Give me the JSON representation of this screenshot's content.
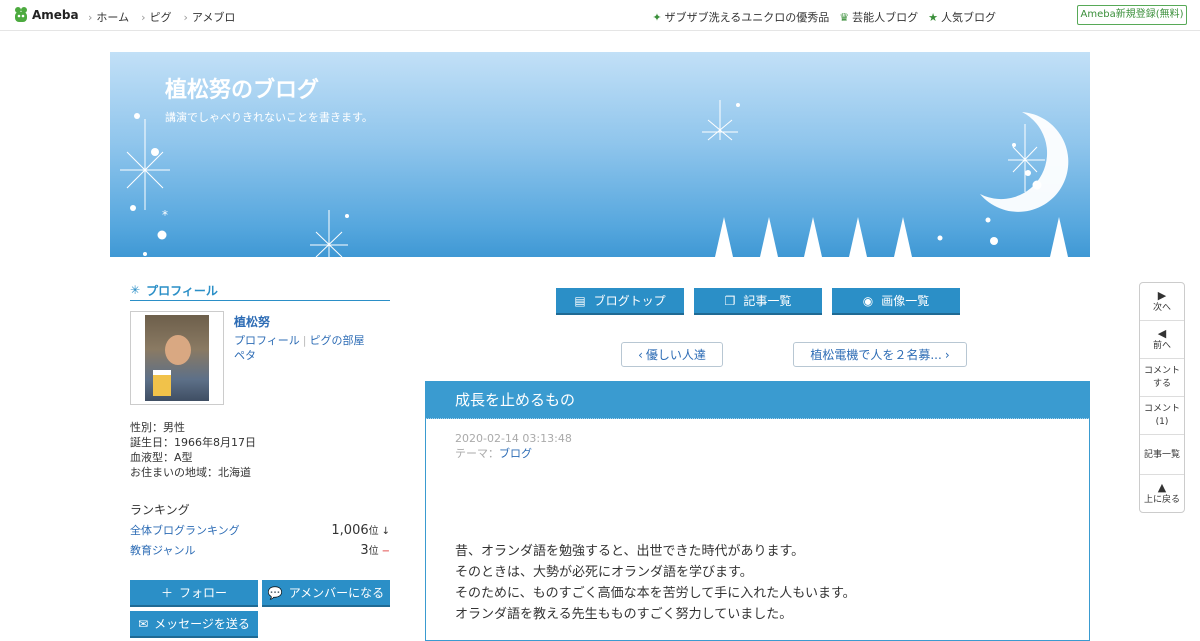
{
  "topbar": {
    "logo": "Ameba",
    "nav_left": [
      "ホーム",
      "ピグ",
      "アメブロ"
    ],
    "nav_right": [
      {
        "icon": "sparkle-icon",
        "label": "ザブザブ洗えるユニクロの優秀品"
      },
      {
        "icon": "crown-icon",
        "label": "芸能人ブログ"
      },
      {
        "icon": "star-icon",
        "label": "人気ブログ"
      }
    ],
    "register": "Ameba新規登録(無料)"
  },
  "banner": {
    "title": "植松努のブログ",
    "subtitle": "講演でしゃべりきれないことを書きます。"
  },
  "sidebar": {
    "heading": "プロフィール",
    "name": "植松努",
    "links": [
      "プロフィール",
      "ピグの部屋",
      "ペタ"
    ],
    "attrs": [
      "性別：男性",
      "誕生日：1966年8月17日",
      "血液型：A型",
      "お住まいの地域：北海道"
    ],
    "ranking_heading": "ランキング",
    "ranking": [
      {
        "label": "全体ブログランキング",
        "value": "1,006",
        "unit": "位",
        "trend": "↓"
      },
      {
        "label": "教育ジャンル",
        "value": "3",
        "unit": "位",
        "trend": "−"
      }
    ],
    "follow": "フォロー",
    "amember": "アメンバーになる",
    "message": "メッセージを送る"
  },
  "main": {
    "tabs": [
      "ブログトップ",
      "記事一覧",
      "画像一覧"
    ],
    "prev": "優しい人達",
    "next": "植松電機で人を２名募...",
    "article": {
      "title": "成長を止めるもの",
      "date": "2020-02-14 03:13:48",
      "theme_label": "テーマ：",
      "theme": "ブログ",
      "body": [
        "昔、オランダ語を勉強すると、出世できた時代があります。",
        "そのときは、大勢が必死にオランダ語を学びます。",
        "そのために、ものすごく高価な本を苦労して手に入れた人もいます。",
        "オランダ語を教える先生もものすごく努力していました。"
      ]
    }
  },
  "rail": {
    "next": "次へ",
    "prev": "前へ",
    "comment": "コメント\nする",
    "comment_count": "コメント\n(1)",
    "list": "記事一覧",
    "top": "上に戻る"
  }
}
